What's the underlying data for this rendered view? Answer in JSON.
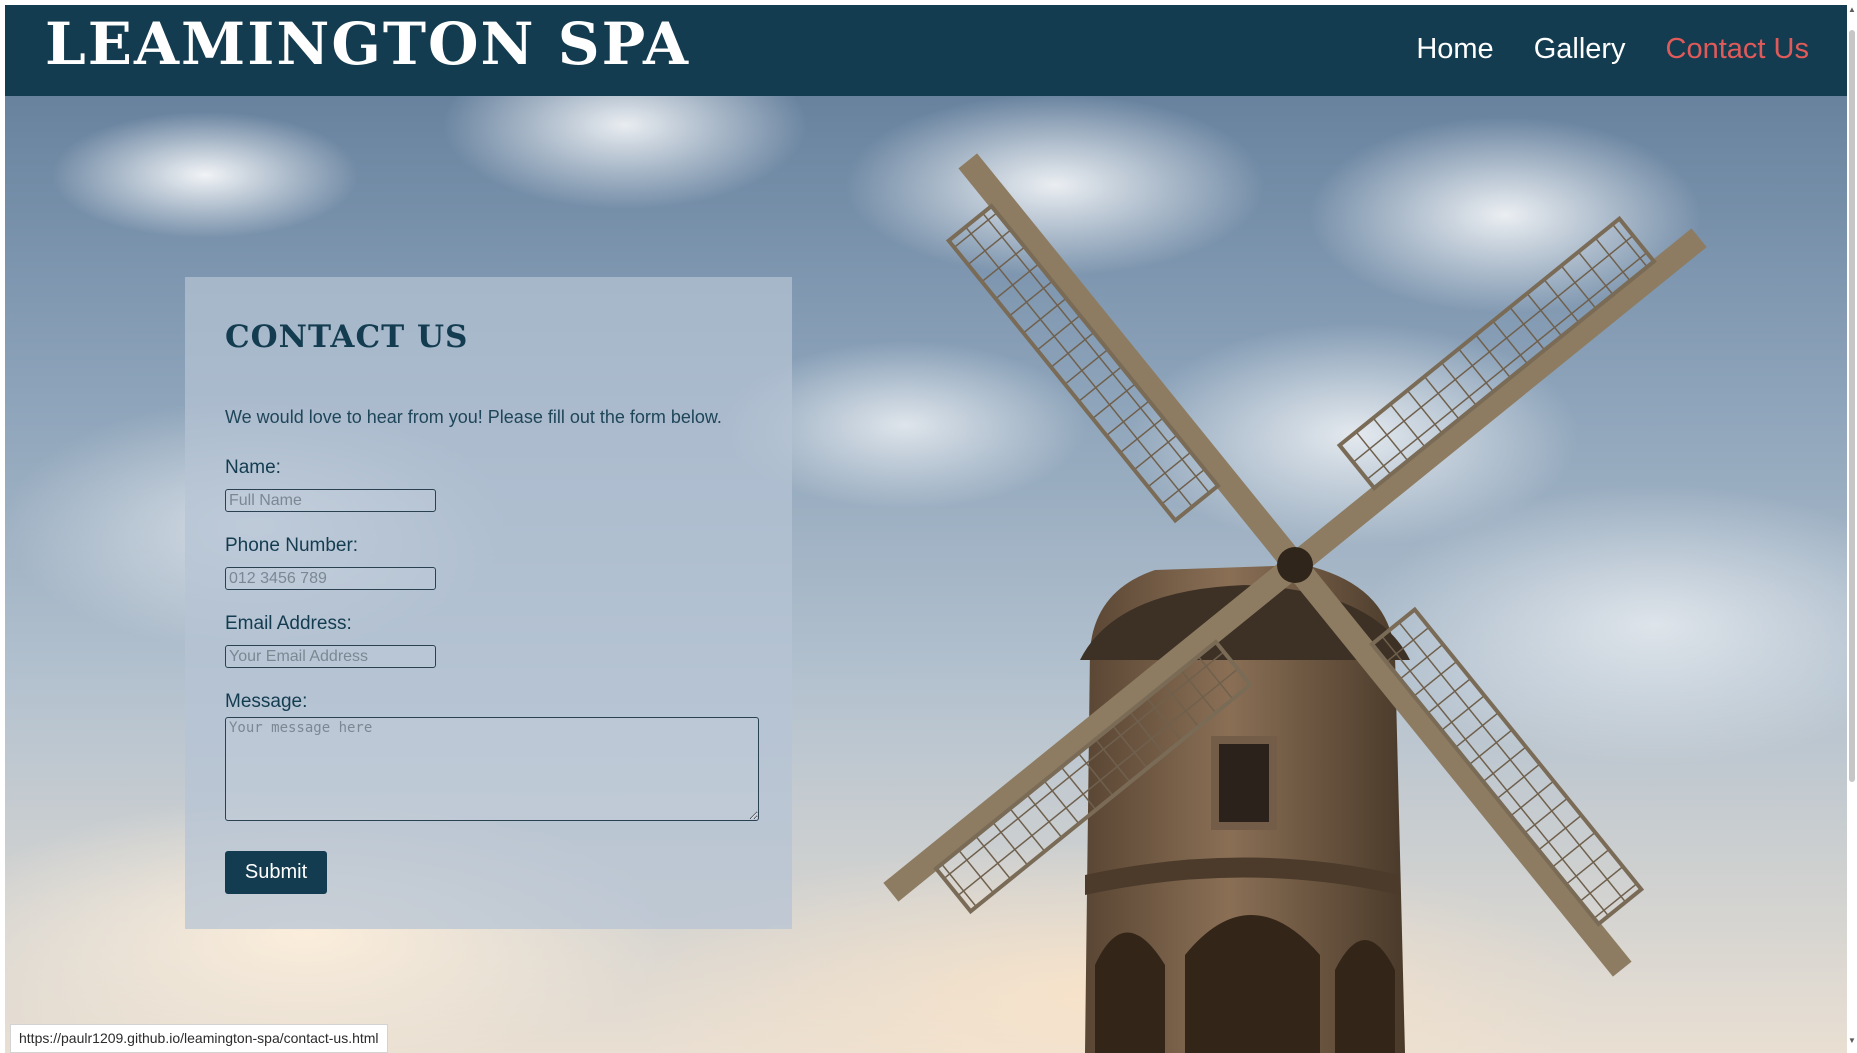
{
  "site": {
    "title": "LEAMINGTON SPA"
  },
  "nav": {
    "items": [
      {
        "label": "Home"
      },
      {
        "label": "Gallery"
      },
      {
        "label": "Contact Us"
      }
    ],
    "active_color": "#e15a5a",
    "text_color": "#ffffff"
  },
  "colors": {
    "header_background": "#143c50",
    "button_background": "#143c50"
  },
  "contact": {
    "title": "CONTACT US",
    "intro": "We would love to hear from you! Please fill out the form below.",
    "fields": {
      "name": {
        "label": "Name:",
        "placeholder": "Full Name",
        "value": ""
      },
      "phone": {
        "label": "Phone Number:",
        "placeholder": "012 3456 789",
        "value": ""
      },
      "email": {
        "label": "Email Address:",
        "placeholder": "Your Email Address",
        "value": ""
      },
      "message": {
        "label": "Message:",
        "placeholder": "Your message here",
        "value": ""
      }
    },
    "submit_label": "Submit"
  },
  "status_bar": {
    "url": "https://paulr1209.github.io/leamington-spa/contact-us.html"
  },
  "background_image": {
    "subject": "windmill-under-cloudy-sky"
  }
}
